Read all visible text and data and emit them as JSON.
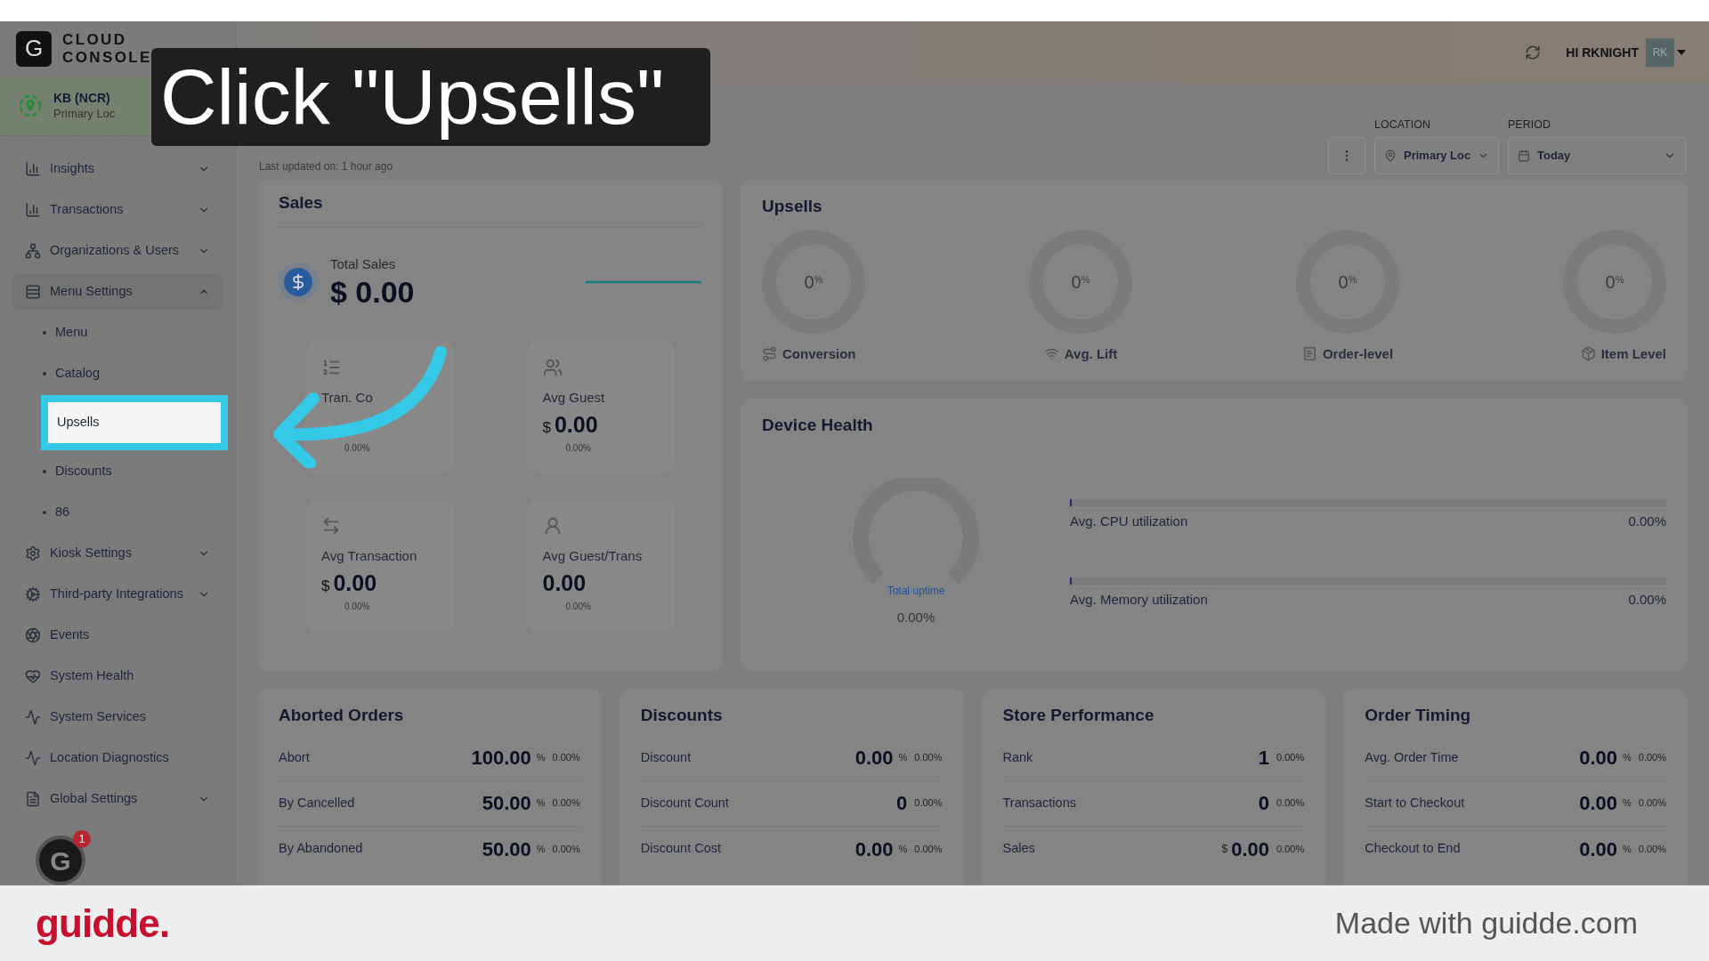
{
  "logo": {
    "mark": "G",
    "line1": "CLOUD",
    "line2": "CONSOLE"
  },
  "location": {
    "name": "KB (NCR)",
    "sub": "Primary Loc"
  },
  "sidebar": {
    "items": [
      {
        "kind": "group",
        "label": "Insights",
        "expanded": false
      },
      {
        "kind": "group",
        "label": "Transactions",
        "expanded": false
      },
      {
        "kind": "group",
        "label": "Organizations & Users",
        "expanded": false
      },
      {
        "kind": "group",
        "label": "Menu Settings",
        "expanded": true,
        "children": [
          {
            "label": "Menu",
            "selected": false
          },
          {
            "label": "Catalog",
            "selected": false
          },
          {
            "label": "Upsells",
            "selected": true
          },
          {
            "label": "Discounts",
            "selected": false
          },
          {
            "label": "86",
            "selected": false
          }
        ]
      },
      {
        "kind": "group",
        "label": "Kiosk Settings",
        "expanded": false
      },
      {
        "kind": "group",
        "label": "Third-party Integrations",
        "expanded": false
      },
      {
        "kind": "link",
        "label": "Events"
      },
      {
        "kind": "link",
        "label": "System Health"
      },
      {
        "kind": "link",
        "label": "System Services"
      },
      {
        "kind": "link",
        "label": "Location Diagnostics"
      },
      {
        "kind": "group",
        "label": "Global Settings",
        "expanded": false
      }
    ]
  },
  "sidebar_badge": {
    "mark": "G",
    "count": "1"
  },
  "header": {
    "greeting": "HI RKNIGHT",
    "avatar": "RK"
  },
  "page": {
    "updated": "Last updated on: 1 hour ago"
  },
  "filters": [
    {
      "label": "LOCATION",
      "value": "Primary Loc"
    },
    {
      "label": "PERIOD",
      "value": "Today"
    }
  ],
  "callout": "Click \"Upsells\"",
  "sales": {
    "title": "Sales",
    "total_label": "Total Sales",
    "total": "$ 0.00",
    "tiles": [
      {
        "label": "Tran. Co",
        "change": "0.00%"
      },
      {
        "label": "Avg Guest",
        "value": "0.00",
        "prefix": "$",
        "change": "0.00%"
      },
      {
        "label": "Avg Transaction",
        "value": "0.00",
        "prefix": "$",
        "change": "0.00%"
      },
      {
        "label": "Avg Guest/Trans",
        "value": "0.00",
        "change": "0.00%"
      }
    ]
  },
  "upsells": {
    "title": "Upsells",
    "gauges": [
      {
        "value": "0",
        "unit": "%",
        "label": "Conversion"
      },
      {
        "value": "0",
        "unit": "%",
        "label": "Avg. Lift"
      },
      {
        "value": "0",
        "unit": "%",
        "label": "Order-level"
      },
      {
        "value": "0",
        "unit": "%",
        "label": "Item Level"
      }
    ]
  },
  "device_health": {
    "title": "Device Health",
    "uptime_label": "Total uptime",
    "uptime": "0.00%",
    "meters": [
      {
        "label": "Avg. CPU utilization",
        "reading": "0.00%",
        "level": 0
      },
      {
        "label": "Avg. Memory utilization",
        "reading": "0.00%",
        "level": 0
      }
    ]
  },
  "cards": [
    {
      "title": "Aborted Orders",
      "rows": [
        {
          "label": "Abort",
          "value": "100.00",
          "unit": "%",
          "change": "0.00%"
        },
        {
          "label": "By Cancelled",
          "value": "50.00",
          "unit": "%",
          "change": "0.00%"
        },
        {
          "label": "By Abandoned",
          "value": "50.00",
          "unit": "%",
          "change": "0.00%"
        }
      ]
    },
    {
      "title": "Discounts",
      "rows": [
        {
          "label": "Discount",
          "value": "0.00",
          "unit": "%",
          "change": "0.00%"
        },
        {
          "label": "Discount Count",
          "value": "0",
          "change": "0.00%"
        },
        {
          "label": "Discount Cost",
          "value": "0.00",
          "unit": "%",
          "change": "0.00%"
        }
      ]
    },
    {
      "title": "Store Performance",
      "rows": [
        {
          "label": "Rank",
          "value": "1",
          "change": "0.00%"
        },
        {
          "label": "Transactions",
          "value": "0",
          "change": "0.00%"
        },
        {
          "label": "Sales",
          "prefix": "$",
          "value": "0.00",
          "change": "0.00%"
        }
      ]
    },
    {
      "title": "Order Timing",
      "rows": [
        {
          "label": "Avg. Order Time",
          "value": "0.00",
          "unit": "%",
          "change": "0.00%"
        },
        {
          "label": "Start to Checkout",
          "value": "0.00",
          "unit": "%",
          "change": "0.00%"
        },
        {
          "label": "Checkout to End",
          "value": "0.00",
          "unit": "%",
          "change": "0.00%"
        }
      ]
    }
  ],
  "footer": {
    "brand": "guidde.",
    "note": "Made with guidde.com"
  }
}
